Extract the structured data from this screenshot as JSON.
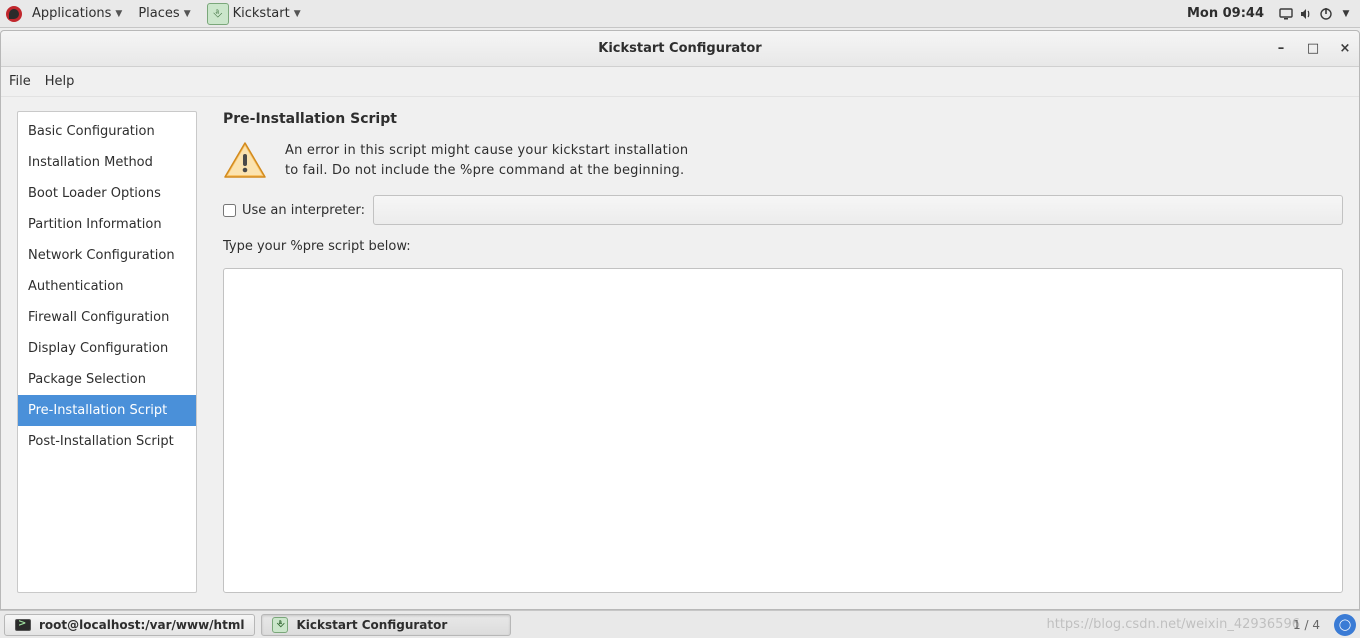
{
  "panel": {
    "apps_label": "Applications",
    "places_label": "Places",
    "active_app": "Kickstart",
    "clock": "Mon 09:44"
  },
  "window": {
    "title": "Kickstart Configurator",
    "menubar": {
      "file": "File",
      "help": "Help"
    }
  },
  "sidebar": {
    "items": [
      "Basic Configuration",
      "Installation Method",
      "Boot Loader Options",
      "Partition Information",
      "Network Configuration",
      "Authentication",
      "Firewall Configuration",
      "Display Configuration",
      "Package Selection",
      "Pre-Installation Script",
      "Post-Installation Script"
    ],
    "selected_index": 9
  },
  "main": {
    "section_title": "Pre-Installation Script",
    "warning_l1": "An error in this script might cause your kickstart installation",
    "warning_l2": "to fail. Do not include the %pre command at the beginning.",
    "interpreter_label": "Use an interpreter:",
    "interpreter_checked": false,
    "interpreter_value": "",
    "hint_label": "Type your %pre script below:",
    "script_value": ""
  },
  "taskbar": {
    "task1": "root@localhost:/var/www/html",
    "task2": "Kickstart Configurator",
    "pager": "1 / 4"
  },
  "watermark": "https://blog.csdn.net/weixin_42936596"
}
